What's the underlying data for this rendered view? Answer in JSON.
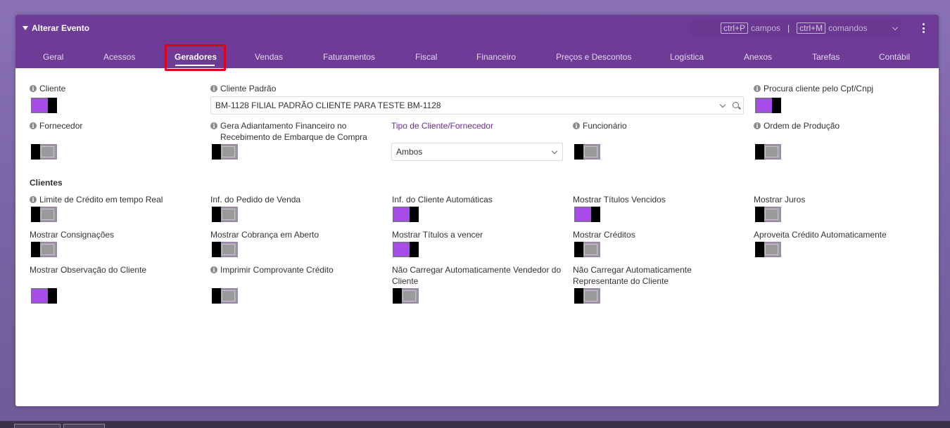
{
  "window": {
    "title": "Alterar Evento"
  },
  "shortcuts": {
    "fields_key": "ctrl+P",
    "fields_label": "campos",
    "separator": "|",
    "commands_key": "ctrl+M",
    "commands_label": "comandos"
  },
  "tabs": [
    {
      "label": "Geral"
    },
    {
      "label": "Acessos"
    },
    {
      "label": "Geradores"
    },
    {
      "label": "Vendas"
    },
    {
      "label": "Faturamentos"
    },
    {
      "label": "Fiscal"
    },
    {
      "label": "Financeiro"
    },
    {
      "label": "Preços e Descontos"
    },
    {
      "label": "Logística"
    },
    {
      "label": "Anexos"
    },
    {
      "label": "Tarefas"
    },
    {
      "label": "Contábil"
    }
  ],
  "active_tab": "Geradores",
  "colors": {
    "header": "#6e3b96",
    "toggle_on": "#a74ce8",
    "highlight": "#e0001b"
  },
  "fields": {
    "cliente": {
      "label": "Cliente",
      "on": true
    },
    "cliente_padrao": {
      "label": "Cliente Padrão",
      "value": "BM-1128 FILIAL PADRÃO CLIENTE PARA TESTE BM-1128"
    },
    "procura_cliente": {
      "label": "Procura cliente pelo Cpf/Cnpj",
      "on": true
    },
    "fornecedor": {
      "label": "Fornecedor",
      "on": false
    },
    "gera_adiantamento": {
      "label_line1": "Gera Adiantamento Financeiro no",
      "label_line2": "Recebimento de Embarque de Compra",
      "on": false
    },
    "tipo_cliente": {
      "label": "Tipo de Cliente/Fornecedor",
      "value": "Ambos"
    },
    "funcionario": {
      "label": "Funcionário",
      "on": false
    },
    "ordem_producao": {
      "label": "Ordem de Produção",
      "on": false
    }
  },
  "clientes_section": {
    "title": "Clientes",
    "items": [
      {
        "label": "Limite de Crédito em tempo Real",
        "on": false,
        "info": true
      },
      {
        "label": "Inf. do Pedido de Venda",
        "on": false
      },
      {
        "label": "Inf. do Cliente Automáticas",
        "on": true
      },
      {
        "label": "Mostrar Títulos Vencidos",
        "on": true
      },
      {
        "label": "Mostrar Juros",
        "on": false
      },
      {
        "label": "Mostrar Consignações",
        "on": false
      },
      {
        "label": "Mostrar Cobrança em Aberto",
        "on": false
      },
      {
        "label": "Mostrar Títulos a vencer",
        "on": true
      },
      {
        "label": "Mostrar Créditos",
        "on": false
      },
      {
        "label": "Aproveita Crédito Automaticamente",
        "on": false
      },
      {
        "label": "Mostrar Observação do Cliente",
        "on": true
      },
      {
        "label": "Imprimir Comprovante Crédito",
        "on": false,
        "info": true
      },
      {
        "label_line1": "Não Carregar Automaticamente Vendedor do",
        "label_line2": "Cliente",
        "on": false
      },
      {
        "label_line1": "Não Carregar Automaticamente",
        "label_line2": "Representante do Cliente",
        "on": false
      }
    ]
  }
}
